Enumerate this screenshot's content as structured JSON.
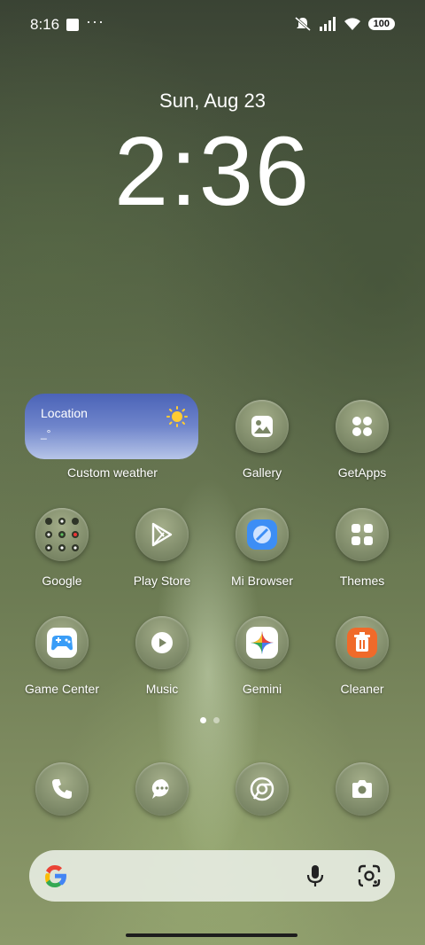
{
  "status": {
    "time": "8:16",
    "more": "···",
    "battery": "100"
  },
  "lock": {
    "date": "Sun, Aug 23",
    "time": "2:36"
  },
  "weather": {
    "location": "Location",
    "temp": "_°",
    "label": "Custom weather"
  },
  "apps": [
    {
      "name": "Gallery",
      "icon": "gallery-icon"
    },
    {
      "name": "GetApps",
      "icon": "getapps-icon"
    },
    {
      "name": "Google",
      "icon": "google-folder-icon"
    },
    {
      "name": "Play Store",
      "icon": "play-store-icon"
    },
    {
      "name": "Mi Browser",
      "icon": "mi-browser-icon"
    },
    {
      "name": "Themes",
      "icon": "themes-icon"
    },
    {
      "name": "Game Center",
      "icon": "game-center-icon"
    },
    {
      "name": "Music",
      "icon": "music-icon"
    },
    {
      "name": "Gemini",
      "icon": "gemini-icon"
    },
    {
      "name": "Cleaner",
      "icon": "cleaner-icon"
    }
  ],
  "dock": [
    "phone-icon",
    "messages-icon",
    "chrome-icon",
    "camera-icon"
  ],
  "pager": {
    "pages": 2,
    "current": 1
  },
  "colors": {
    "accent_blue": "#4b63b7",
    "cleaner_orange": "#f06a2a"
  }
}
